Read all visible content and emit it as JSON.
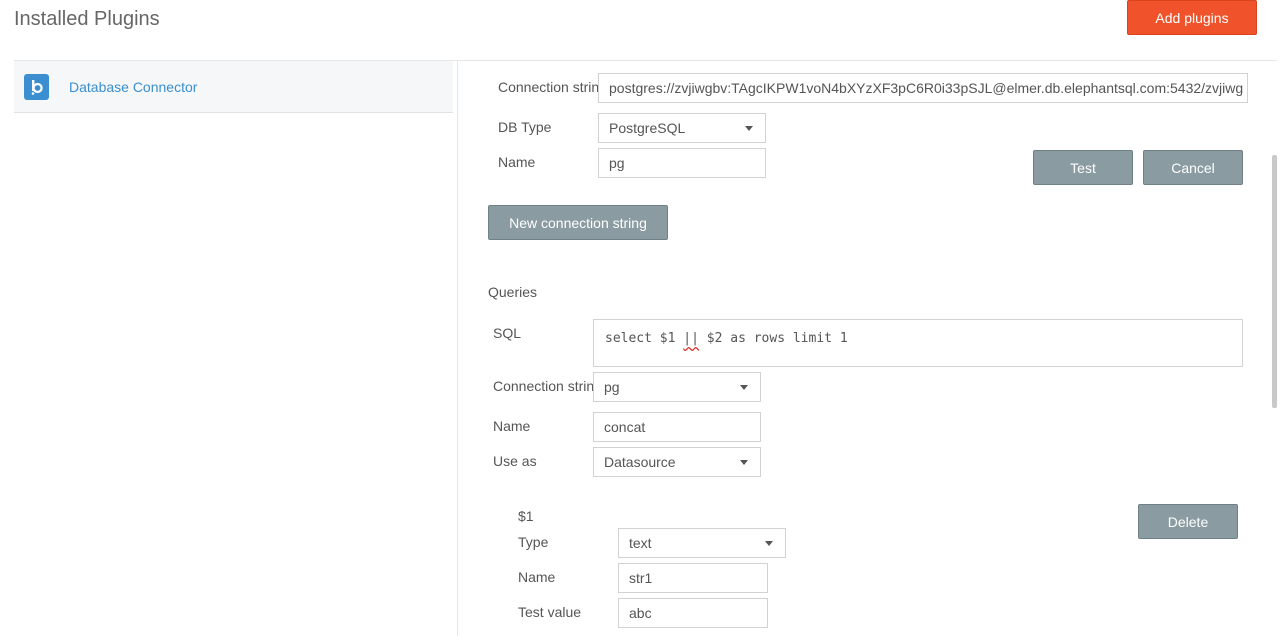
{
  "header": {
    "title": "Installed Plugins",
    "add_button": "Add plugins"
  },
  "sidebar": {
    "items": [
      {
        "label": "Database Connector",
        "icon": "database-connector-logo"
      }
    ]
  },
  "connection": {
    "connection_string_label": "Connection string",
    "connection_string_value": "postgres://zvjiwgbv:TAgcIKPW1voN4bXYzXF3pC6R0i33pSJL@elmer.db.elephantsql.com:5432/zvjiwg",
    "db_type_label": "DB Type",
    "db_type_value": "PostgreSQL",
    "name_label": "Name",
    "name_value": "pg",
    "test_button": "Test",
    "cancel_button": "Cancel",
    "new_connection_button": "New connection string"
  },
  "queries": {
    "section_label": "Queries",
    "sql_label": "SQL",
    "sql_before": "select $1 ",
    "sql_flagged": "||",
    "sql_after": " $2 as rows limit 1",
    "connection_string_label": "Connection string",
    "connection_string_value": "pg",
    "name_label": "Name",
    "name_value": "concat",
    "use_as_label": "Use as",
    "use_as_value": "Datasource"
  },
  "parameter": {
    "title": "$1",
    "delete_button": "Delete",
    "type_label": "Type",
    "type_value": "text",
    "name_label": "Name",
    "name_value": "str1",
    "test_value_label": "Test value",
    "test_value": "abc"
  },
  "colors": {
    "accent": "#f0532b",
    "link": "#3b8fd0",
    "button_grey": "#8a9ba2"
  }
}
